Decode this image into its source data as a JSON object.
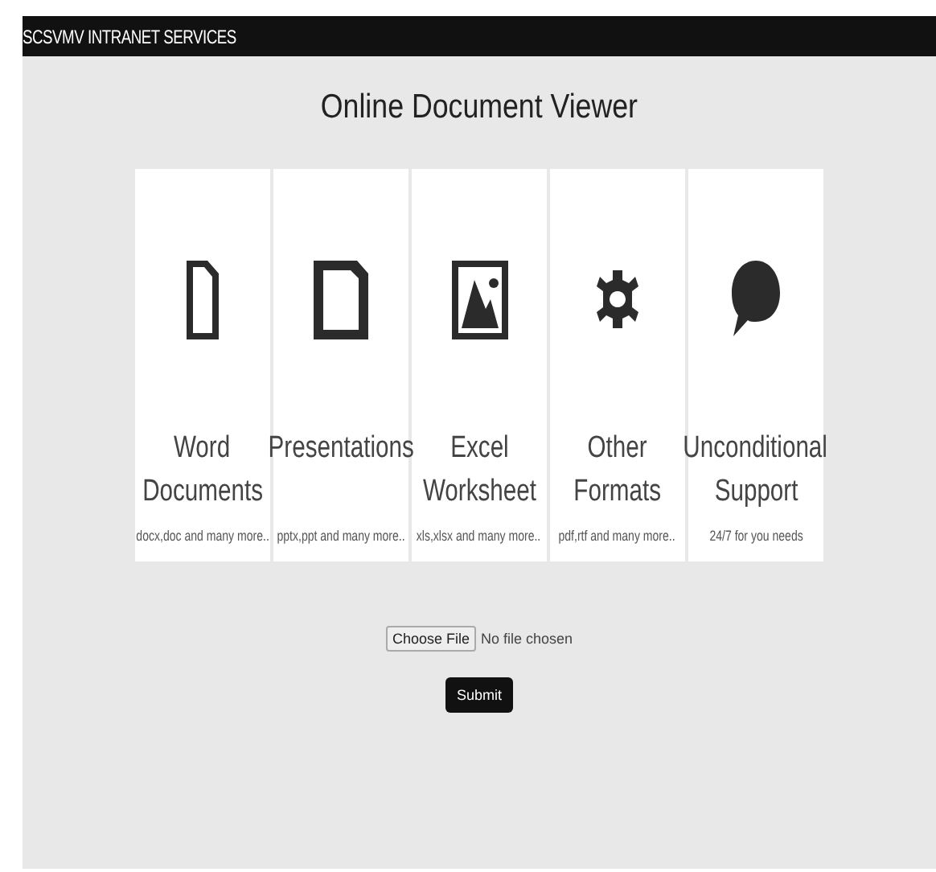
{
  "header": {
    "title": "SCSVMV INTRANET SERVICES"
  },
  "heading": "Online Document Viewer",
  "cards": [
    {
      "title": [
        "Word",
        "Documents"
      ],
      "subtitle": "docx,doc and many more.."
    },
    {
      "title": [
        "Presentations"
      ],
      "subtitle": "pptx,ppt and many more.."
    },
    {
      "title": [
        "Excel",
        "Worksheet"
      ],
      "subtitle": "xls,xlsx and many more.."
    },
    {
      "title": [
        "Other",
        "Formats"
      ],
      "subtitle": "pdf,rtf and many more.."
    },
    {
      "title": [
        "Unconditional",
        "Support"
      ],
      "subtitle": "24/7 for you needs"
    }
  ],
  "file_input": {
    "button": "Choose File",
    "status": "No file chosen"
  },
  "submit": "Submit"
}
